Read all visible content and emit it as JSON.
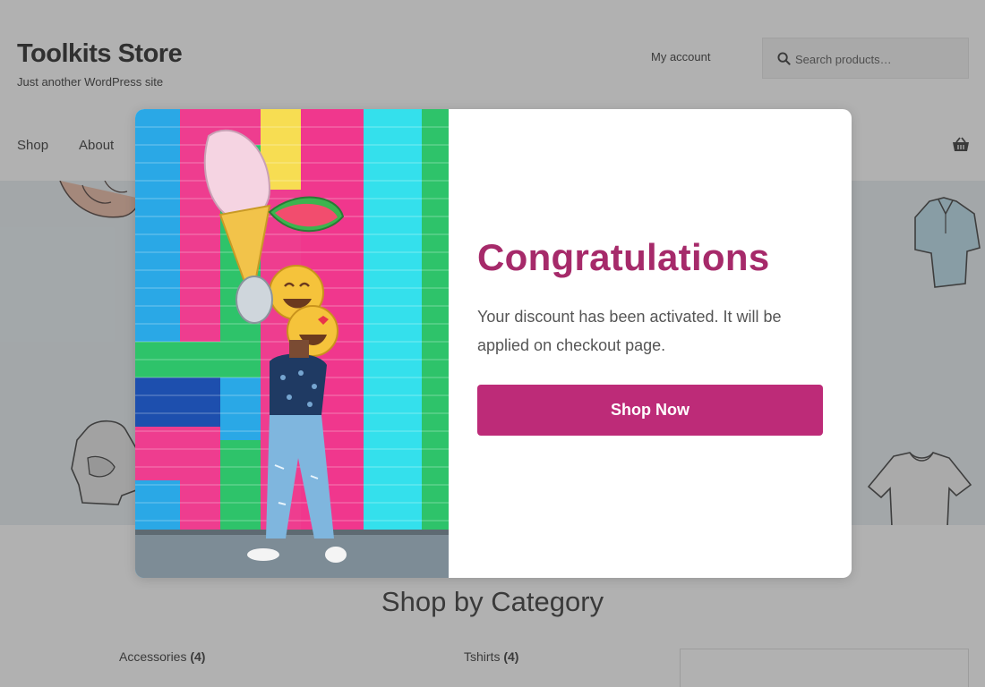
{
  "header": {
    "site_title": "Toolkits Store",
    "tagline": "Just another WordPress site",
    "my_account": "My account",
    "search_placeholder": "Search products…"
  },
  "nav": {
    "items": [
      {
        "label": "Shop"
      },
      {
        "label": "About"
      }
    ]
  },
  "sections": {
    "shop_by_category": "Shop by Category",
    "categories": [
      {
        "name": "Accessories",
        "count": "(4)"
      },
      {
        "name": "Tshirts",
        "count": "(4)"
      }
    ]
  },
  "modal": {
    "title": "Congratulations",
    "message": "Your discount has been activated. It will be applied on checkout page.",
    "button_label": "Shop Now"
  },
  "colors": {
    "accent": "#a62a6a",
    "button": "#bd2b78",
    "overlay": "rgba(70,70,70,0.42)"
  },
  "icons": {
    "search": "search-icon",
    "cart": "basket-icon"
  }
}
